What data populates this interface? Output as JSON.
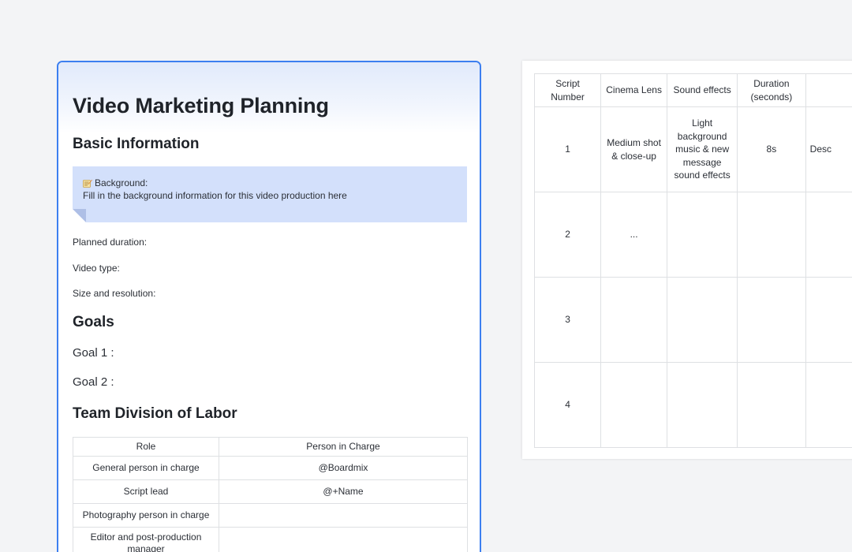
{
  "document": {
    "title": "Video Marketing Planning",
    "basic_info": {
      "heading": "Basic Information",
      "callout": {
        "icon": "memo-icon",
        "title": "Background:",
        "text": "Fill in the background information for this video production here"
      },
      "fields": [
        {
          "label": "Planned duration:"
        },
        {
          "label": "Video type:"
        },
        {
          "label": "Size and resolution:"
        }
      ]
    },
    "goals": {
      "heading": "Goals",
      "items": [
        "Goal 1 :",
        "Goal 2 :"
      ]
    },
    "team": {
      "heading": "Team Division of Labor",
      "columns": [
        "Role",
        "Person in Charge"
      ],
      "rows": [
        {
          "role": "General person in charge",
          "person": "@Boardmix"
        },
        {
          "role": "Script lead",
          "person": "@+Name"
        },
        {
          "role": "Photography person in charge",
          "person": ""
        },
        {
          "role": "Editor and post-production manager",
          "person": ""
        }
      ]
    }
  },
  "script_table": {
    "columns": [
      "Script Number",
      "Cinema Lens",
      "Sound effects",
      "Duration (seconds)",
      ""
    ],
    "rows": [
      {
        "number": "1",
        "lens": "Medium shot & close-up",
        "sound": "Light background music & new message sound effects",
        "duration": "8s",
        "extra": "Desc"
      },
      {
        "number": "2",
        "lens": "...",
        "sound": "",
        "duration": "",
        "extra": ""
      },
      {
        "number": "3",
        "lens": "",
        "sound": "",
        "duration": "",
        "extra": ""
      },
      {
        "number": "4",
        "lens": "",
        "sound": "",
        "duration": "",
        "extra": ""
      }
    ]
  },
  "colors": {
    "accent_border": "#3c7ff0",
    "callout_bg": "#d3e0fb",
    "canvas_bg": "#f3f4f6"
  }
}
